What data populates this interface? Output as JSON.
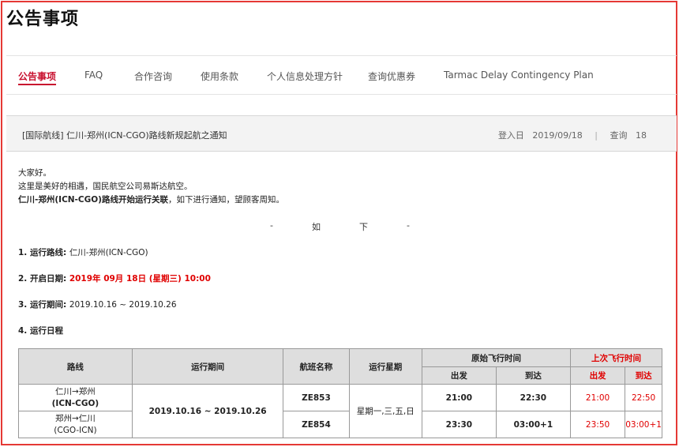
{
  "page": {
    "title": "公告事项"
  },
  "tabs": [
    {
      "label": "公告事项",
      "active": true
    },
    {
      "label": "FAQ",
      "active": false
    },
    {
      "label": "合作咨询",
      "active": false
    },
    {
      "label": "使用条款",
      "active": false
    },
    {
      "label": "个人信息处理方针",
      "active": false
    },
    {
      "label": "查询优惠券",
      "active": false
    },
    {
      "label": "Tarmac Delay Contingency Plan",
      "active": false
    }
  ],
  "article": {
    "subject": "[国际航线] 仁川-郑州(ICN-CGO)路线新规起航之通知",
    "date_label": "登入日",
    "date": "2019/09/18",
    "views_label": "查询",
    "views": "18"
  },
  "body": {
    "greeting": "大家好。",
    "intro": "这里是美好的相遇，国民航空公司易斯达航空。",
    "route_bold": "仁川-郑州(ICN-CGO)路线开始运行关联",
    "route_rest": "，如下进行通知，望顾客周知。",
    "heading_chars": [
      "-",
      "如",
      "下",
      "-"
    ],
    "item1_label": "1. 运行路线: ",
    "item1_value": "仁川-郑州(ICN-CGO)",
    "item2_label": "2. 开启日期: ",
    "item2_value": "2019年 09月 18日 (星期三) 10:00",
    "item3_label": "3. 运行期间: ",
    "item3_value": "2019.10.16 ~ 2019.10.26",
    "item4_label": "4. 运行日程"
  },
  "schedule": {
    "headers": {
      "route": "路线",
      "period": "运行期间",
      "flight": "航班名称",
      "weekday": "运行星期",
      "original": "原始飞行时间",
      "last": "上次飞行时间",
      "dep": "出发",
      "arr": "到达"
    },
    "period": "2019.10.16 ~ 2019.10.26",
    "weekdays": "星期一,三,五,日",
    "rows": [
      {
        "route_line1": "仁川→郑州",
        "route_line2": "(ICN-CGO)",
        "flight": "ZE853",
        "orig_dep": "21:00",
        "orig_arr": "22:30",
        "last_dep": "21:00",
        "last_arr": "22:50"
      },
      {
        "route_line1": "郑州→仁川",
        "route_line2": "(CGO-ICN)",
        "flight": "ZE854",
        "orig_dep": "23:30",
        "orig_arr": "03:00+1",
        "last_dep": "23:50",
        "last_arr": "03:00+1"
      }
    ]
  },
  "colors": {
    "accent_red": "#c8102e",
    "alert_red": "#e00000",
    "frame_red": "#e53935"
  }
}
